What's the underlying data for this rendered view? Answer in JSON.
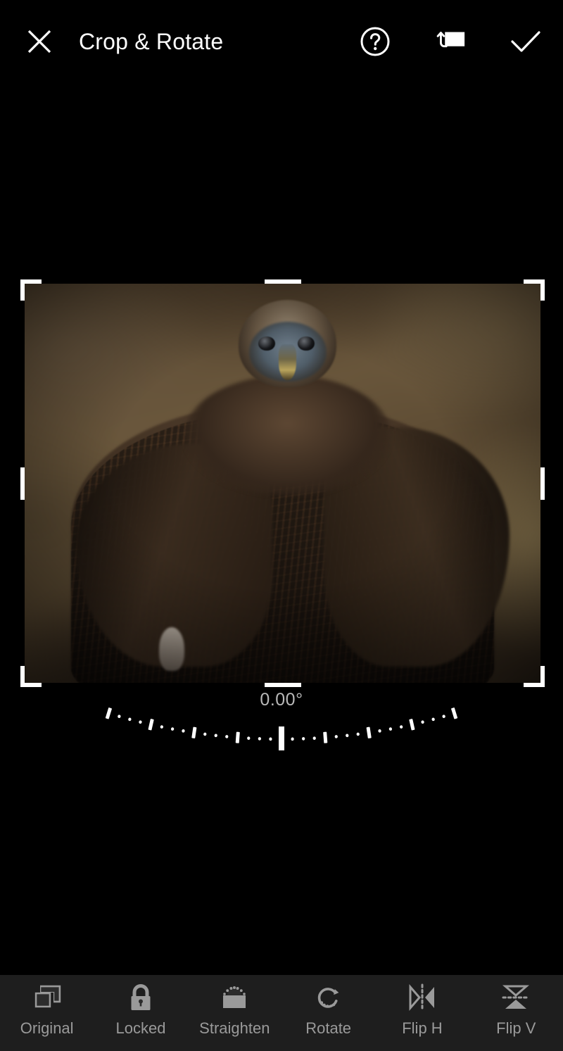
{
  "app": {
    "background_color": "#000000",
    "toolbar_background": "#1e1e1e",
    "accent_color": "#ffffff",
    "label_color": "#9a9a9a"
  },
  "header": {
    "title": "Crop & Rotate",
    "close_label": "Close",
    "help_label": "Help",
    "aspect_ratio_label": "Aspect Ratio",
    "done_label": "Done",
    "icons": {
      "close": "close-icon",
      "help": "help-circle-icon",
      "aspect": "aspect-ratio-icon",
      "done": "checkmark-icon"
    }
  },
  "canvas": {
    "crop_frame": {
      "handles": [
        "top-left",
        "top-right",
        "bottom-left",
        "bottom-right",
        "top",
        "bottom",
        "left",
        "right"
      ]
    },
    "photo": {
      "subject": "cinereous vulture",
      "description": "Close-up portrait of a dark brown vulture facing the camera against a blurred warm brown rock background",
      "colors": {
        "background": "#6a573c",
        "plumage": "#3c2d20",
        "face": "#5e7082",
        "beak": "#b9a45c"
      }
    }
  },
  "dial": {
    "angle_value": "0.00°",
    "angle_number": 0.0,
    "unit": "degrees",
    "indicator": "center-tick"
  },
  "toolbar": {
    "items": [
      {
        "label": "Original",
        "icon": "layers-icon",
        "name": "tool-original"
      },
      {
        "label": "Locked",
        "icon": "lock-icon",
        "name": "tool-locked"
      },
      {
        "label": "Straighten",
        "icon": "straighten-icon",
        "name": "tool-straighten"
      },
      {
        "label": "Rotate",
        "icon": "rotate-cw-icon",
        "name": "tool-rotate"
      },
      {
        "label": "Flip H",
        "icon": "flip-h-icon",
        "name": "tool-flip-h"
      },
      {
        "label": "Flip V",
        "icon": "flip-v-icon",
        "name": "tool-flip-v"
      }
    ]
  }
}
